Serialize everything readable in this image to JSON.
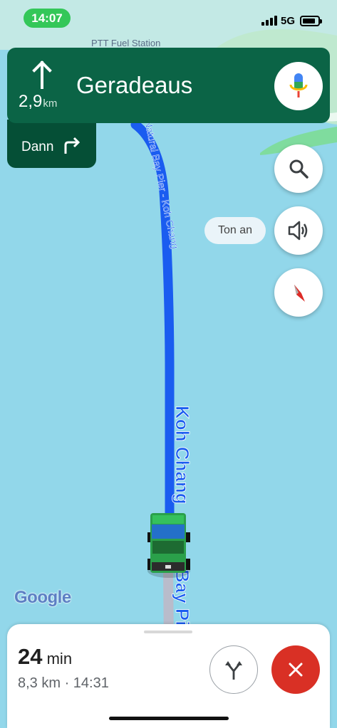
{
  "status_bar": {
    "time": "14:07",
    "network": "5G"
  },
  "map": {
    "poi_label": "PTT Fuel Station",
    "route_label_upper": "Natural Bay Pier - Koh Chang",
    "route_label_lower": "Koh Chang",
    "route_label_bottom": "Bay Pi",
    "water_color": "#92d7ea",
    "route_color": "#1a5cf0"
  },
  "navigation": {
    "maneuver_icon": "straight-arrow-icon",
    "distance_value": "2,9",
    "distance_unit": "km",
    "street": "Geradeaus",
    "then_label": "Dann",
    "then_icon": "turn-right-icon",
    "banner_color": "#0b6446"
  },
  "controls": {
    "sound_chip": "Ton an"
  },
  "attribution": {
    "logo": "Google"
  },
  "trip": {
    "duration_value": "24",
    "duration_unit": "min",
    "summary": "8,3 km · 14:31"
  }
}
